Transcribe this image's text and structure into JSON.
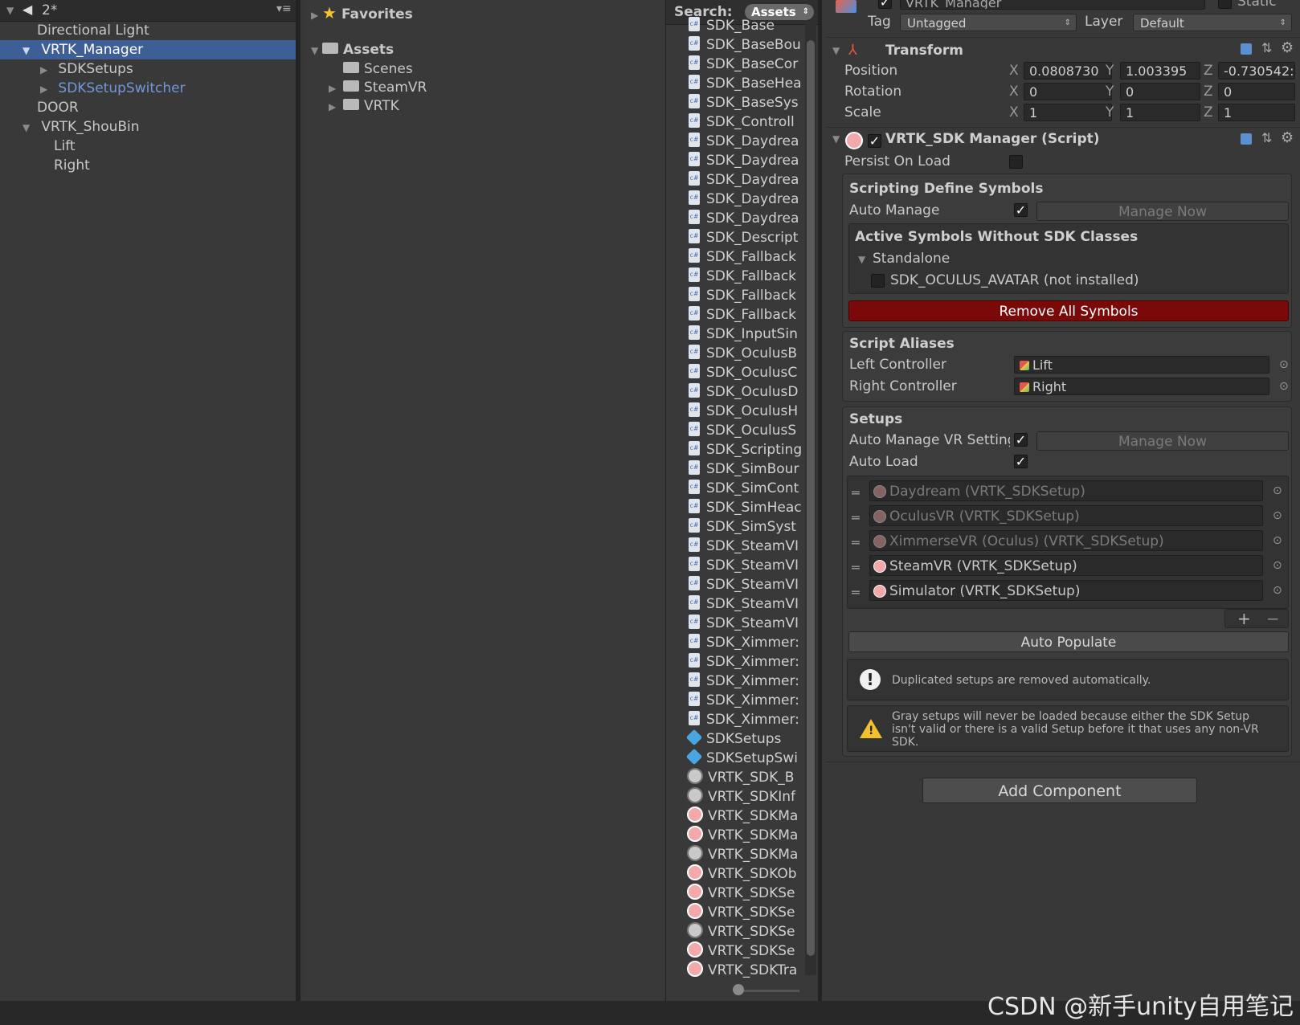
{
  "hierarchy": {
    "scene_name": "2*",
    "items": [
      {
        "label": "Directional Light"
      },
      {
        "label": "VRTK_Manager"
      },
      {
        "label": "SDKSetups"
      },
      {
        "label": "SDKSetupSwitcher"
      },
      {
        "label": "DOOR"
      },
      {
        "label": "VRTK_ShouBin"
      },
      {
        "label": "Lift"
      },
      {
        "label": "Right"
      }
    ]
  },
  "project": {
    "favorites_label": "Favorites",
    "assets_label": "Assets",
    "folders": [
      {
        "label": "Scenes"
      },
      {
        "label": "SteamVR"
      },
      {
        "label": "VRTK"
      }
    ],
    "search_label": "Search:",
    "search_scope": "Assets",
    "files": [
      {
        "label": "SDK_Base",
        "icon": "cs-script-icon"
      },
      {
        "label": "SDK_BaseBou",
        "icon": "cs-script-icon"
      },
      {
        "label": "SDK_BaseCor",
        "icon": "cs-script-icon"
      },
      {
        "label": "SDK_BaseHea",
        "icon": "cs-script-icon"
      },
      {
        "label": "SDK_BaseSys",
        "icon": "cs-script-icon"
      },
      {
        "label": "SDK_Controll",
        "icon": "cs-script-icon"
      },
      {
        "label": "SDK_Daydrea",
        "icon": "cs-script-icon"
      },
      {
        "label": "SDK_Daydrea",
        "icon": "cs-script-icon"
      },
      {
        "label": "SDK_Daydrea",
        "icon": "cs-script-icon"
      },
      {
        "label": "SDK_Daydrea",
        "icon": "cs-script-icon"
      },
      {
        "label": "SDK_Daydrea",
        "icon": "cs-script-icon"
      },
      {
        "label": "SDK_Descript",
        "icon": "cs-script-icon"
      },
      {
        "label": "SDK_Fallback",
        "icon": "cs-script-icon"
      },
      {
        "label": "SDK_Fallback",
        "icon": "cs-script-icon"
      },
      {
        "label": "SDK_Fallback",
        "icon": "cs-script-icon"
      },
      {
        "label": "SDK_Fallback",
        "icon": "cs-script-icon"
      },
      {
        "label": "SDK_InputSin",
        "icon": "cs-script-icon"
      },
      {
        "label": "SDK_OculusB",
        "icon": "cs-script-icon"
      },
      {
        "label": "SDK_OculusC",
        "icon": "cs-script-icon"
      },
      {
        "label": "SDK_OculusD",
        "icon": "cs-script-icon"
      },
      {
        "label": "SDK_OculusH",
        "icon": "cs-script-icon"
      },
      {
        "label": "SDK_OculusS",
        "icon": "cs-script-icon"
      },
      {
        "label": "SDK_Scripting",
        "icon": "cs-script-icon"
      },
      {
        "label": "SDK_SimBour",
        "icon": "cs-script-icon"
      },
      {
        "label": "SDK_SimCont",
        "icon": "cs-script-icon"
      },
      {
        "label": "SDK_SimHeac",
        "icon": "cs-script-icon"
      },
      {
        "label": "SDK_SimSyst",
        "icon": "cs-script-icon"
      },
      {
        "label": "SDK_SteamVI",
        "icon": "cs-script-icon"
      },
      {
        "label": "SDK_SteamVI",
        "icon": "cs-script-icon"
      },
      {
        "label": "SDK_SteamVI",
        "icon": "cs-script-icon"
      },
      {
        "label": "SDK_SteamVI",
        "icon": "cs-script-icon"
      },
      {
        "label": "SDK_SteamVI",
        "icon": "cs-script-icon"
      },
      {
        "label": "SDK_Ximmer:",
        "icon": "cs-script-icon"
      },
      {
        "label": "SDK_Ximmer:",
        "icon": "cs-script-icon"
      },
      {
        "label": "SDK_Ximmer:",
        "icon": "cs-script-icon"
      },
      {
        "label": "SDK_Ximmer:",
        "icon": "cs-script-icon"
      },
      {
        "label": "SDK_Ximmer:",
        "icon": "cs-script-icon"
      },
      {
        "label": "SDKSetups",
        "icon": "prefab-icon"
      },
      {
        "label": "SDKSetupSwi",
        "icon": "prefab-icon"
      },
      {
        "label": "VRTK_SDK_B",
        "icon": "no-script-icon"
      },
      {
        "label": "VRTK_SDKInf",
        "icon": "no-script-icon"
      },
      {
        "label": "VRTK_SDKMa",
        "icon": "vrtk-script-icon"
      },
      {
        "label": "VRTK_SDKMa",
        "icon": "vrtk-script-icon"
      },
      {
        "label": "VRTK_SDKMa",
        "icon": "no-script-icon"
      },
      {
        "label": "VRTK_SDKOb",
        "icon": "vrtk-script-icon"
      },
      {
        "label": "VRTK_SDKSe",
        "icon": "vrtk-script-icon"
      },
      {
        "label": "VRTK_SDKSe",
        "icon": "vrtk-script-icon"
      },
      {
        "label": "VRTK_SDKSe",
        "icon": "no-script-icon"
      },
      {
        "label": "VRTK_SDKSe",
        "icon": "vrtk-script-icon"
      },
      {
        "label": "VRTK_SDKTra",
        "icon": "vrtk-script-icon"
      }
    ]
  },
  "inspector": {
    "object_name": "VRTK_Manager",
    "static_label": "Static",
    "tag_label": "Tag",
    "tag_value": "Untagged",
    "layer_label": "Layer",
    "layer_value": "Default",
    "transform": {
      "title": "Transform",
      "position_label": "Position",
      "rotation_label": "Rotation",
      "scale_label": "Scale",
      "axis_x": "X",
      "axis_y": "Y",
      "axis_z": "Z",
      "position": {
        "x": "0.0808730",
        "y": "1.003395",
        "z": "-0.730542:"
      },
      "rotation": {
        "x": "0",
        "y": "0",
        "z": "0"
      },
      "scale": {
        "x": "1",
        "y": "1",
        "z": "1"
      }
    },
    "sdk_manager": {
      "title": "VRTK_SDK Manager (Script)",
      "persist_label": "Persist On Load",
      "persist_checked": false,
      "scripting": {
        "title": "Scripting Define Symbols",
        "auto_manage_label": "Auto Manage",
        "auto_manage_checked": true,
        "manage_now": "Manage Now",
        "active_title": "Active Symbols Without SDK Classes",
        "standalone": "Standalone",
        "symbol": "SDK_OCULUS_AVATAR (not installed)",
        "remove_all": "Remove All Symbols"
      },
      "aliases": {
        "title": "Script Aliases",
        "left_label": "Left Controller",
        "left_value": "Lift",
        "right_label": "Right Controller",
        "right_value": "Right"
      },
      "setups": {
        "title": "Setups",
        "auto_manage_vr_label": "Auto Manage VR Setting",
        "auto_manage_vr_checked": true,
        "manage_now": "Manage Now",
        "auto_load_label": "Auto Load",
        "auto_load_checked": true,
        "list": [
          {
            "label": "Daydream (VRTK_SDKSetup)",
            "enabled": false
          },
          {
            "label": "OculusVR (VRTK_SDKSetup)",
            "enabled": false
          },
          {
            "label": "XimmerseVR (Oculus) (VRTK_SDKSetup)",
            "enabled": false
          },
          {
            "label": "SteamVR (VRTK_SDKSetup)",
            "enabled": true
          },
          {
            "label": "Simulator (VRTK_SDKSetup)",
            "enabled": true
          }
        ],
        "plus": "+",
        "minus": "−",
        "auto_populate": "Auto Populate",
        "info_text": "Duplicated setups are removed automatically.",
        "warning_lines": [
          "Gray setups will never be loaded because either the SDK Setup",
          "isn't valid or there is a valid Setup before it that uses any non-VR",
          "SDK."
        ]
      }
    },
    "add_component": "Add Component"
  },
  "watermark": "CSDN @新手unity自用笔记",
  "colors": {
    "selection": "#3e5f96",
    "prefab_text": "#6f98d8",
    "remove_button": "#7a0a0a",
    "warning": "#f3c12d"
  }
}
